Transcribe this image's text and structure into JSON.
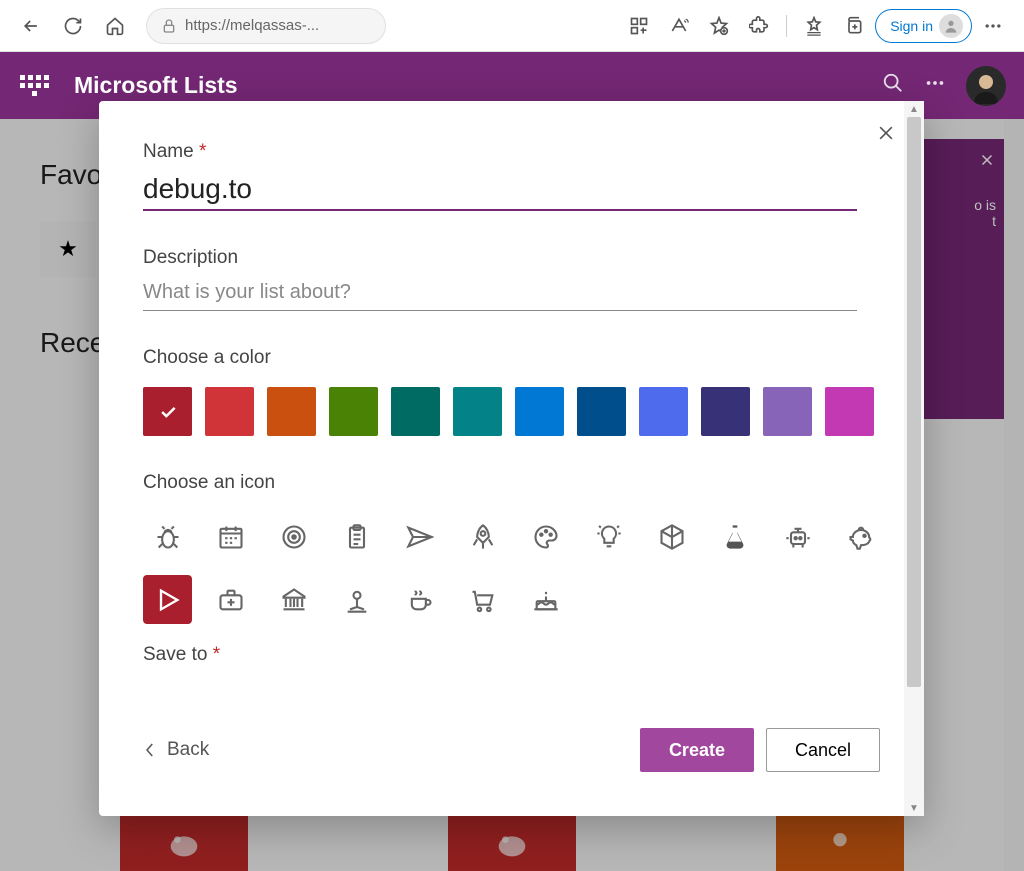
{
  "browser": {
    "url": "https://melqassas-...",
    "signin_label": "Sign in"
  },
  "app": {
    "title": "Microsoft Lists"
  },
  "page": {
    "favorites_heading": "Favo",
    "recent_heading": "Rece",
    "panel_text": "o is",
    "panel_text2": "t"
  },
  "modal": {
    "name_label": "Name",
    "name_value": "debug.to",
    "description_label": "Description",
    "description_placeholder": "What is your list about?",
    "choose_color_label": "Choose a color",
    "choose_icon_label": "Choose an icon",
    "save_to_label": "Save to",
    "back_label": "Back",
    "create_label": "Create",
    "cancel_label": "Cancel",
    "colors": [
      {
        "name": "dark-red",
        "hex": "#a91f2e",
        "selected": true
      },
      {
        "name": "red",
        "hex": "#d13438"
      },
      {
        "name": "orange",
        "hex": "#ca5010"
      },
      {
        "name": "green",
        "hex": "#498205"
      },
      {
        "name": "teal-dark",
        "hex": "#006b62"
      },
      {
        "name": "teal",
        "hex": "#038387"
      },
      {
        "name": "blue",
        "hex": "#0078d4"
      },
      {
        "name": "navy",
        "hex": "#004e8c"
      },
      {
        "name": "blue-light",
        "hex": "#4f6bed"
      },
      {
        "name": "indigo",
        "hex": "#373277"
      },
      {
        "name": "purple",
        "hex": "#8764b8"
      },
      {
        "name": "pink",
        "hex": "#c239b3"
      }
    ]
  }
}
